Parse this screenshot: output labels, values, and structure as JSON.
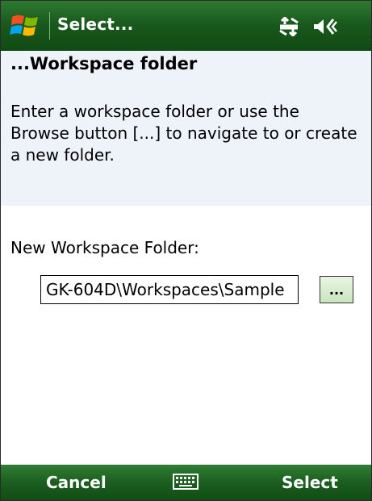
{
  "titlebar": {
    "title": "Select...",
    "start_icon": "windows-flag-icon",
    "status_icons": [
      "connectivity-arrows-icon",
      "volume-speaker-icon"
    ]
  },
  "header": {
    "heading": "...Workspace folder",
    "instructions": "Enter a workspace folder or use the Browse button [...] to navigate to or create a new folder."
  },
  "form": {
    "field_label": "New Workspace Folder:",
    "folder_value": "GK-604D\\Workspaces\\Sample",
    "browse_label": "..."
  },
  "softkeys": {
    "left": "Cancel",
    "center_icon": "keyboard-icon",
    "right": "Select"
  },
  "colors": {
    "titlebar_green": "#1a5a1e",
    "info_background": "#eef2f9",
    "browse_button_green": "#c9e6bd"
  }
}
